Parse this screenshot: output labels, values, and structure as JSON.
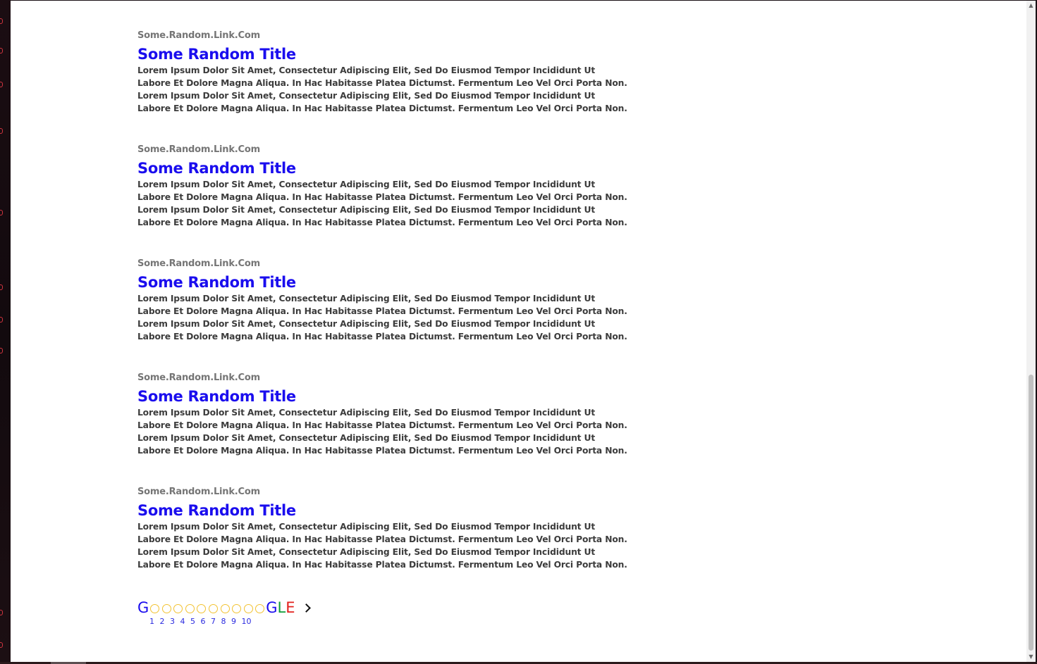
{
  "results": [
    {
      "url": "Some.Random.Link.Com",
      "title": "Some Random Title",
      "snippet": "Lorem Ipsum Dolor Sit Amet, Consectetur Adipiscing Elit, Sed Do Eiusmod Tempor Incididunt Ut Labore Et Dolore Magna Aliqua. In Hac Habitasse Platea Dictumst. Fermentum Leo Vel Orci Porta Non. Lorem Ipsum Dolor Sit Amet, Consectetur Adipiscing Elit, Sed Do Eiusmod Tempor Incididunt Ut Labore Et Dolore Magna Aliqua. In Hac Habitasse Platea Dictumst. Fermentum Leo Vel Orci Porta Non."
    },
    {
      "url": "Some.Random.Link.Com",
      "title": "Some Random Title",
      "snippet": "Lorem Ipsum Dolor Sit Amet, Consectetur Adipiscing Elit, Sed Do Eiusmod Tempor Incididunt Ut Labore Et Dolore Magna Aliqua. In Hac Habitasse Platea Dictumst. Fermentum Leo Vel Orci Porta Non. Lorem Ipsum Dolor Sit Amet, Consectetur Adipiscing Elit, Sed Do Eiusmod Tempor Incididunt Ut Labore Et Dolore Magna Aliqua. In Hac Habitasse Platea Dictumst. Fermentum Leo Vel Orci Porta Non."
    },
    {
      "url": "Some.Random.Link.Com",
      "title": "Some Random Title",
      "snippet": "Lorem Ipsum Dolor Sit Amet, Consectetur Adipiscing Elit, Sed Do Eiusmod Tempor Incididunt Ut Labore Et Dolore Magna Aliqua. In Hac Habitasse Platea Dictumst. Fermentum Leo Vel Orci Porta Non. Lorem Ipsum Dolor Sit Amet, Consectetur Adipiscing Elit, Sed Do Eiusmod Tempor Incididunt Ut Labore Et Dolore Magna Aliqua. In Hac Habitasse Platea Dictumst. Fermentum Leo Vel Orci Porta Non."
    },
    {
      "url": "Some.Random.Link.Com",
      "title": "Some Random Title",
      "snippet": "Lorem Ipsum Dolor Sit Amet, Consectetur Adipiscing Elit, Sed Do Eiusmod Tempor Incididunt Ut Labore Et Dolore Magna Aliqua. In Hac Habitasse Platea Dictumst. Fermentum Leo Vel Orci Porta Non. Lorem Ipsum Dolor Sit Amet, Consectetur Adipiscing Elit, Sed Do Eiusmod Tempor Incididunt Ut Labore Et Dolore Magna Aliqua. In Hac Habitasse Platea Dictumst. Fermentum Leo Vel Orci Porta Non."
    },
    {
      "url": "Some.Random.Link.Com",
      "title": "Some Random Title",
      "snippet": "Lorem Ipsum Dolor Sit Amet, Consectetur Adipiscing Elit, Sed Do Eiusmod Tempor Incididunt Ut Labore Et Dolore Magna Aliqua. In Hac Habitasse Platea Dictumst. Fermentum Leo Vel Orci Porta Non. Lorem Ipsum Dolor Sit Amet, Consectetur Adipiscing Elit, Sed Do Eiusmod Tempor Incididunt Ut Labore Et Dolore Magna Aliqua. In Hac Habitasse Platea Dictumst. Fermentum Leo Vel Orci Porta Non."
    }
  ],
  "pagination": {
    "logo": {
      "g_first": "G",
      "g_last": "G",
      "l": "L",
      "e": "E",
      "o_count": 10
    },
    "colors": {
      "g_first": "#1a0dee",
      "o": "#f2c230",
      "g_last": "#1a0dee",
      "l": "#0f9d3a",
      "e": "#e2201c"
    },
    "pages": [
      "1",
      "2",
      "3",
      "4",
      "5",
      "6",
      "7",
      "8",
      "9",
      "10"
    ],
    "next_icon": "chevron-right-icon"
  },
  "colors": {
    "link": "#1a0dee",
    "url": "#757575",
    "snippet": "#3c3c3c",
    "page_link": "#2a2ae0"
  }
}
